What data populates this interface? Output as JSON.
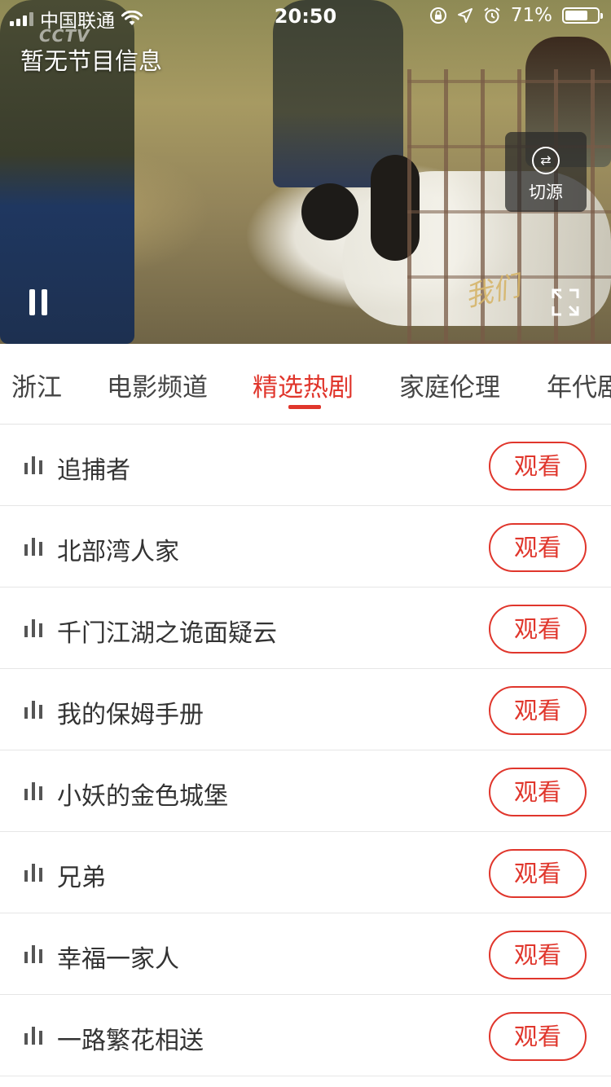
{
  "status_bar": {
    "carrier": "中国联通",
    "time": "20:50",
    "battery": "71%",
    "battery_level": 0.71
  },
  "player": {
    "channel_logo": "CCTV",
    "program_info": "暂无节目信息",
    "switch_source_label": "切源",
    "watermark": "我们一起走过",
    "icons": [
      "pause-icon",
      "fullscreen-icon",
      "switch-source-icon"
    ]
  },
  "tabs": [
    {
      "label": "浙江",
      "active": false
    },
    {
      "label": "电影频道",
      "active": false
    },
    {
      "label": "精选热剧",
      "active": true
    },
    {
      "label": "家庭伦理",
      "active": false
    },
    {
      "label": "年代剧",
      "active": false
    }
  ],
  "list": {
    "items": [
      {
        "title": "追捕者",
        "action": "观看"
      },
      {
        "title": "北部湾人家",
        "action": "观看"
      },
      {
        "title": "千门江湖之诡面疑云",
        "action": "观看"
      },
      {
        "title": "我的保姆手册",
        "action": "观看"
      },
      {
        "title": "小妖的金色城堡",
        "action": "观看"
      },
      {
        "title": "兄弟",
        "action": "观看"
      },
      {
        "title": "幸福一家人",
        "action": "观看"
      },
      {
        "title": "一路繁花相送",
        "action": "观看"
      }
    ]
  },
  "colors": {
    "accent": "#e0362c",
    "text": "#333333",
    "divider": "#e6e6e6"
  }
}
